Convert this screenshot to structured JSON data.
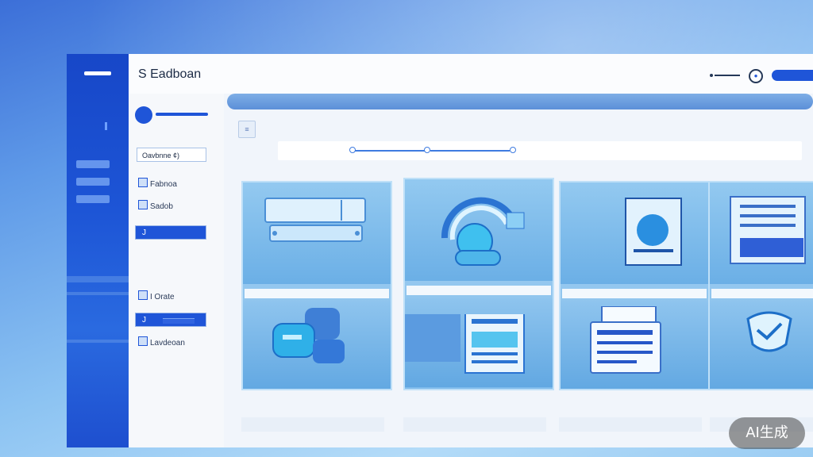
{
  "app": {
    "title": "S Eadboan"
  },
  "colors": {
    "accent": "#1f55d8",
    "rail": "#1d55d6",
    "panel": "#f1f5fb"
  },
  "titlebar": {
    "icons": [
      "minimize-icon",
      "settings-icon",
      "action-button"
    ]
  },
  "sidebar": {
    "select_label": "Oavbnne  ¢)",
    "items": [
      {
        "label": "Fabnoa",
        "icon": "folder-icon"
      },
      {
        "label": "Sadob",
        "icon": "file-icon"
      },
      {
        "label": "J",
        "icon": "",
        "selected": true
      },
      {
        "label": "I  Orate",
        "icon": "folder-icon"
      },
      {
        "label": "J",
        "icon": "",
        "selected": true
      },
      {
        "label": "Lavdeoan",
        "icon": "folder-icon"
      }
    ]
  },
  "toolbar": {
    "filter_label": "≡"
  },
  "cards": [
    {
      "top_icon": "server-icon",
      "bottom_icon": "chat-bubbles-icon"
    },
    {
      "top_icon": "cloud-icon",
      "bottom_icon": "document-icon"
    },
    {
      "top_icon": "image-document-icon",
      "bottom_icon": "form-document-icon"
    },
    {
      "top_icon": "report-document-icon",
      "bottom_icon": "shield-icon"
    }
  ],
  "badge": {
    "text": "AI生成"
  }
}
